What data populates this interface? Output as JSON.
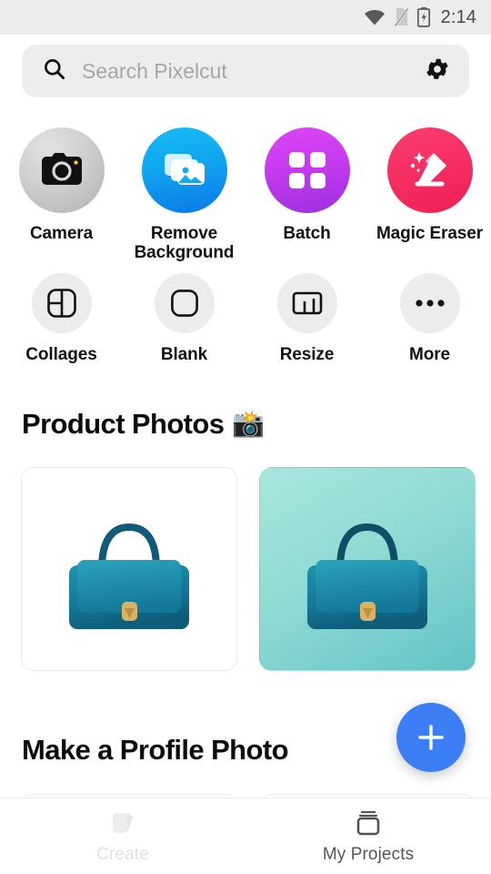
{
  "status_bar": {
    "time": "2:14",
    "icons": [
      "wifi-icon",
      "no-sim-icon",
      "battery-charging-icon"
    ]
  },
  "search": {
    "placeholder": "Search Pixelcut",
    "value": "",
    "search_icon": "search-icon",
    "settings_icon": "gear-icon"
  },
  "actions": {
    "row1": [
      {
        "label": "Camera",
        "icon": "camera-icon",
        "color_start": "#d8d8d8",
        "color_end": "#b4b4b4"
      },
      {
        "label": "Remove Background",
        "icon": "photo-stack-icon",
        "color_start": "#15b7f2",
        "color_end": "#0f7ce8"
      },
      {
        "label": "Batch",
        "icon": "grid-squares-icon",
        "color_start": "#d43df2",
        "color_end": "#9b30e0"
      },
      {
        "label": "Magic Eraser",
        "icon": "magic-eraser-icon",
        "color_start": "#f8336b",
        "color_end": "#f2265f"
      }
    ],
    "row2": [
      {
        "label": "Collages",
        "icon": "collage-icon"
      },
      {
        "label": "Blank",
        "icon": "rounded-square-icon"
      },
      {
        "label": "Resize",
        "icon": "resize-icon"
      },
      {
        "label": "More",
        "icon": "ellipsis-icon"
      }
    ]
  },
  "sections": [
    {
      "title": "Product Photos",
      "emoji": "📸"
    },
    {
      "title": "Make a Profile Photo",
      "emoji": ""
    }
  ],
  "product_photos": [
    {
      "alt": "teal leather handbag on white background",
      "background": "white"
    },
    {
      "alt": "teal leather handbag on teal gradient background",
      "background": "teal-gradient"
    }
  ],
  "fab": {
    "label": "+",
    "icon": "plus-icon",
    "color": "#3b7ef5"
  },
  "bottom_nav": [
    {
      "label": "Create",
      "icon": "create-icon",
      "state": "inactive"
    },
    {
      "label": "My Projects",
      "icon": "projects-icon",
      "state": "active"
    }
  ]
}
